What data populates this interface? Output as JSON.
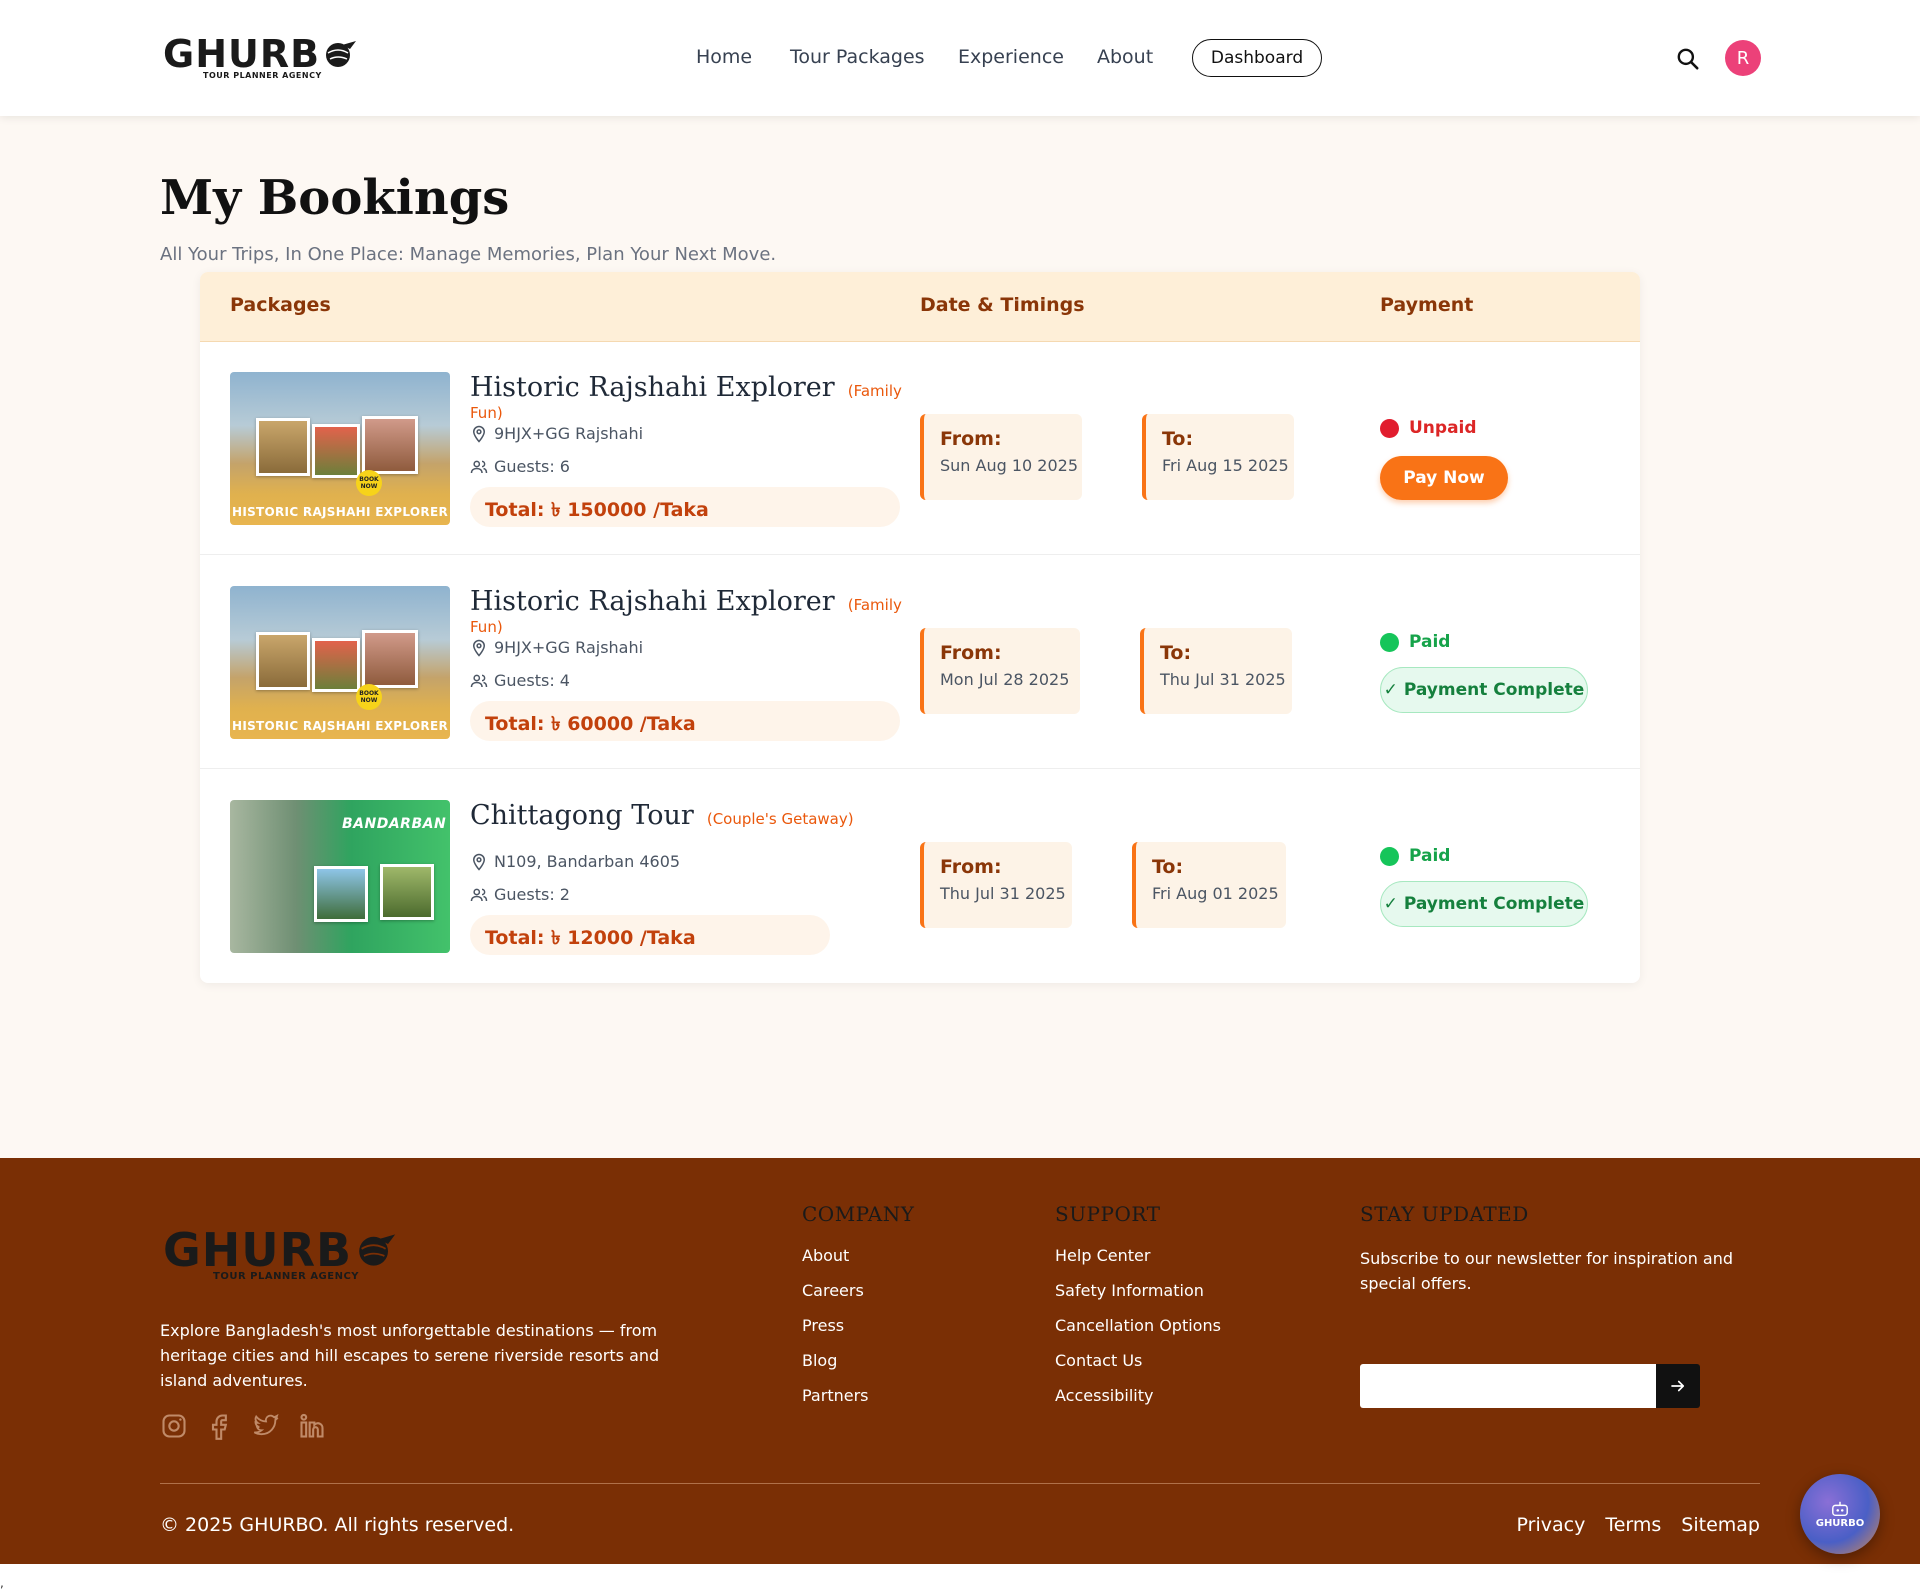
{
  "brand": {
    "name": "GHURB",
    "tagline": "TOUR PLANNER AGENCY"
  },
  "nav": {
    "home": "Home",
    "tours": "Tour Packages",
    "experience": "Experience",
    "about": "About",
    "dashboard": "Dashboard"
  },
  "user": {
    "initial": "R",
    "avatar_color": "#ec4179"
  },
  "page": {
    "title": "My Bookings",
    "subtitle": "All Your Trips, In One Place: Manage Memories, Plan Your Next Move."
  },
  "table": {
    "headers": {
      "packages": "Packages",
      "dates": "Date & Timings",
      "payment": "Payment"
    },
    "from_label": "From:",
    "to_label": "To:",
    "rows": [
      {
        "title": "Historic Rajshahi Explorer",
        "category": "(Family Fun)",
        "location": "9HJX+GG Rajshahi",
        "guests": "Guests: 6",
        "total": "Total: ৳ 150000 /Taka",
        "from": "Sun Aug 10 2025",
        "to": "Fri Aug 15 2025",
        "status": "Unpaid",
        "status_color": "#e11d2e",
        "action": "Pay Now",
        "thumb_caption": "HISTORIC RAJSHAHI EXPLORER",
        "badge": "BOOK NOW"
      },
      {
        "title": "Historic Rajshahi Explorer",
        "category": "(Family Fun)",
        "location": "9HJX+GG Rajshahi",
        "guests": "Guests: 4",
        "total": "Total: ৳ 60000 /Taka",
        "from": "Mon Jul 28 2025",
        "to": "Thu Jul 31 2025",
        "status": "Paid",
        "status_color": "#16a34a",
        "action": "✓ Payment Complete",
        "thumb_caption": "HISTORIC RAJSHAHI EXPLORER",
        "badge": "BOOK NOW"
      },
      {
        "title": "Chittagong Tour",
        "category": "(Couple's Getaway)",
        "location": "N109, Bandarban 4605",
        "guests": "Guests: 2",
        "total": "Total: ৳ 12000 /Taka",
        "from": "Thu Jul 31 2025",
        "to": "Fri Aug 01 2025",
        "status": "Paid",
        "status_color": "#16a34a",
        "action": "✓ Payment Complete",
        "thumb_caption": "BANDARBAN"
      }
    ]
  },
  "footer": {
    "description": "Explore Bangladesh's most unforgettable destinations — from heritage cities and hill escapes to serene riverside resorts and island adventures.",
    "company": {
      "heading": "COMPANY",
      "links": [
        "About",
        "Careers",
        "Press",
        "Blog",
        "Partners"
      ]
    },
    "support": {
      "heading": "SUPPORT",
      "links": [
        "Help Center",
        "Safety Information",
        "Cancellation Options",
        "Contact Us",
        "Accessibility"
      ]
    },
    "newsletter": {
      "heading": "STAY UPDATED",
      "text": "Subscribe to our newsletter for inspiration and special offers.",
      "placeholder": ""
    },
    "copyright": "© 2025 GHURBO. All rights reserved.",
    "legal": [
      "Privacy",
      "Terms",
      "Sitemap"
    ]
  },
  "fab": {
    "label": "GHURBO"
  },
  "stray_char": ","
}
